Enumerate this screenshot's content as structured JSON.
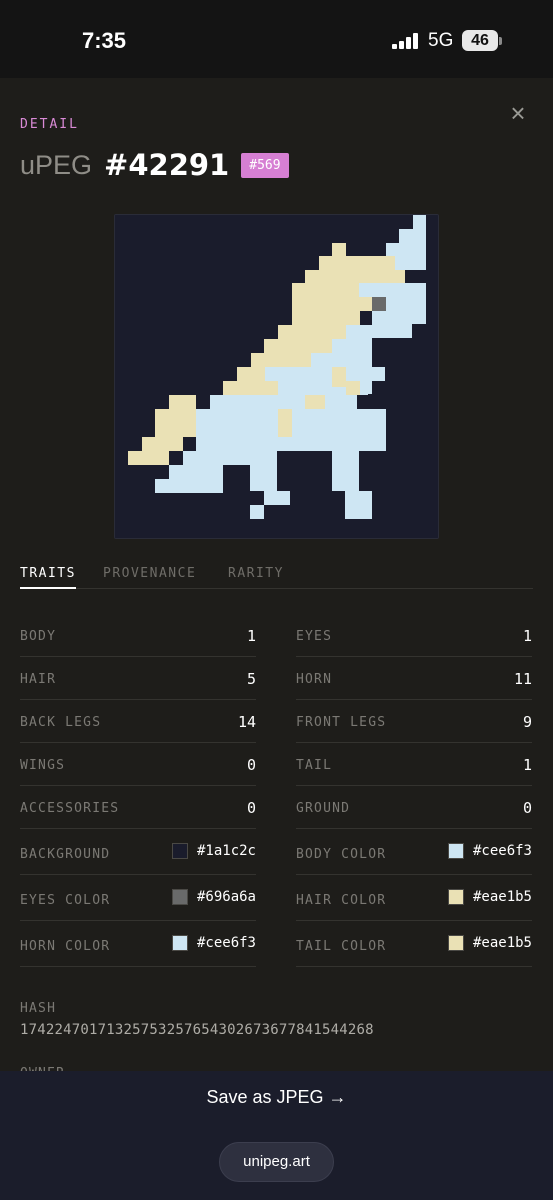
{
  "status_bar": {
    "time": "7:35",
    "network": "5G",
    "battery": "46"
  },
  "header": {
    "section_label": "DETAIL",
    "title_prefix": "uPEG",
    "title_number": "#42291",
    "rank_badge": "#569",
    "close_icon": "×"
  },
  "artwork": {
    "background": "#1a1c2c",
    "body_color": "#cee6f3",
    "hair_color": "#eae1b5",
    "eye_color": "#696a6a"
  },
  "tabs": [
    {
      "label": "TRAITS",
      "active": true
    },
    {
      "label": "PROVENANCE",
      "active": false
    },
    {
      "label": "RARITY",
      "active": false
    }
  ],
  "traits_left": [
    {
      "label": "BODY",
      "value": "1"
    },
    {
      "label": "HAIR",
      "value": "5"
    },
    {
      "label": "BACK LEGS",
      "value": "14"
    },
    {
      "label": "WINGS",
      "value": "0"
    },
    {
      "label": "ACCESSORIES",
      "value": "0"
    }
  ],
  "traits_right": [
    {
      "label": "EYES",
      "value": "1"
    },
    {
      "label": "HORN",
      "value": "11"
    },
    {
      "label": "FRONT LEGS",
      "value": "9"
    },
    {
      "label": "TAIL",
      "value": "1"
    },
    {
      "label": "GROUND",
      "value": "0"
    }
  ],
  "colors_left": [
    {
      "label": "BACKGROUND",
      "value": "#1a1c2c"
    },
    {
      "label": "EYES COLOR",
      "value": "#696a6a"
    },
    {
      "label": "HORN COLOR",
      "value": "#cee6f3"
    }
  ],
  "colors_right": [
    {
      "label": "BODY COLOR",
      "value": "#cee6f3"
    },
    {
      "label": "HAIR COLOR",
      "value": "#eae1b5"
    },
    {
      "label": "TAIL COLOR",
      "value": "#eae1b5"
    }
  ],
  "hash": {
    "label": "HASH",
    "value": "17422470171325753257654302673677841544268"
  },
  "owner": {
    "label": "OWNER"
  },
  "footer": {
    "save_label": "Save as JPEG →",
    "site_label": "unipeg.art"
  }
}
